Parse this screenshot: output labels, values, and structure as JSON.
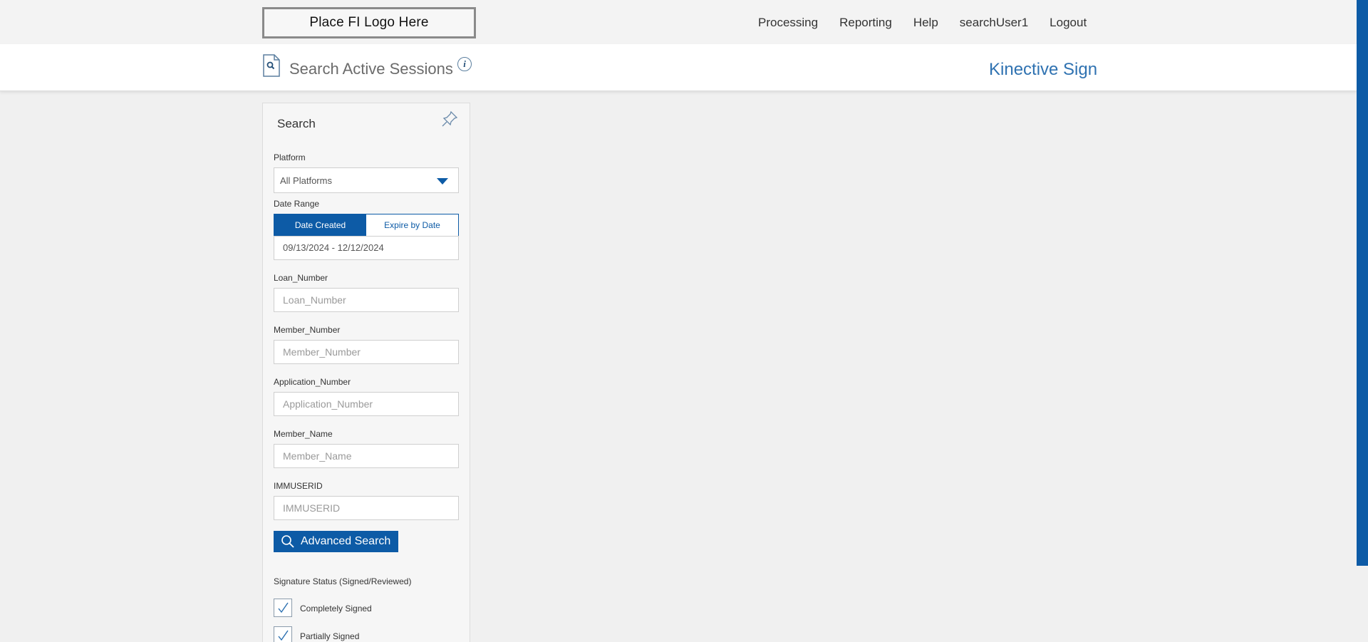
{
  "header": {
    "logo_text": "Place FI Logo Here",
    "nav": [
      "Processing",
      "Reporting",
      "Help",
      "searchUser1",
      "Logout"
    ]
  },
  "page": {
    "title": "Search Active Sessions",
    "info_glyph": "i",
    "brand": "Kinective Sign"
  },
  "search_panel": {
    "title": "Search",
    "platform": {
      "label": "Platform",
      "value": "All Platforms"
    },
    "date_range": {
      "label": "Date Range",
      "options": [
        "Date Created",
        "Expire by Date"
      ],
      "selected": "Date Created",
      "value": "09/13/2024 - 12/12/2024"
    },
    "fields": [
      {
        "label": "Loan_Number",
        "placeholder": "Loan_Number"
      },
      {
        "label": "Member_Number",
        "placeholder": "Member_Number"
      },
      {
        "label": "Application_Number",
        "placeholder": "Application_Number"
      },
      {
        "label": "Member_Name",
        "placeholder": "Member_Name"
      },
      {
        "label": "IMMUSERID",
        "placeholder": "IMMUSERID"
      }
    ],
    "advanced_search_label": "Advanced Search",
    "signature_status": {
      "label": "Signature Status (Signed/Reviewed)",
      "options": [
        {
          "label": "Completely Signed",
          "checked": true
        },
        {
          "label": "Partially Signed",
          "checked": true
        }
      ]
    }
  },
  "colors": {
    "accent": "#0d5ba6",
    "brand_text": "#2f72b1",
    "background": "#f0f0f0"
  },
  "icons": [
    "document-search-icon",
    "info-icon",
    "pin-icon",
    "chevron-down-icon",
    "search-icon",
    "checkmark-icon"
  ]
}
